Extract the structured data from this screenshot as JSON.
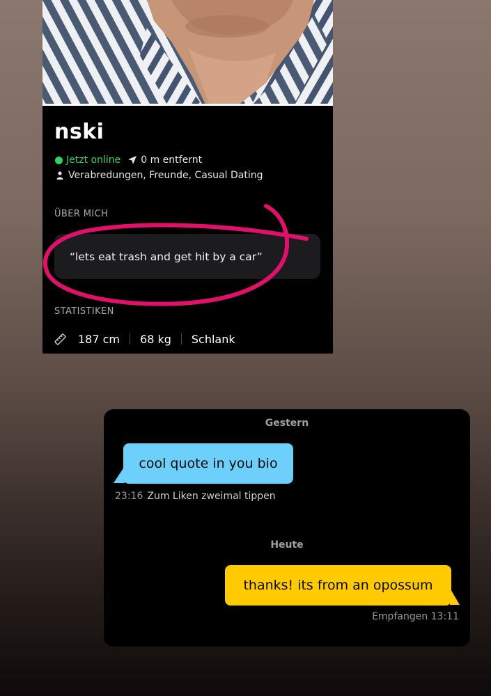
{
  "profile": {
    "name": "nski",
    "status": "Jetzt online",
    "distance": "0 m entfernt",
    "looking_for": "Verabredungen, Freunde, Casual Dating",
    "about_label": "ÜBER MICH",
    "about_text": "“lets eat trash and get hit by a car”",
    "stats_label": "STATISTIKEN",
    "stats": [
      "187 cm",
      "68 kg",
      "Schlank"
    ],
    "colors": {
      "online": "#2fd25a",
      "highlight": "#e0106b"
    },
    "icons": [
      "navigation-arrow-icon",
      "person-icon",
      "ruler-icon"
    ]
  },
  "chat": {
    "day1_label": "Gestern",
    "incoming_message": "cool quote in you bio",
    "incoming_time": "23:16",
    "incoming_hint": "Zum Liken zweimal tippen",
    "day2_label": "Heute",
    "outgoing_message": "thanks! its from an opossum",
    "outgoing_receipt": "Empfangen 13:11",
    "colors": {
      "incoming_bubble": "#6dd0fb",
      "outgoing_bubble": "#ffcb00"
    }
  }
}
